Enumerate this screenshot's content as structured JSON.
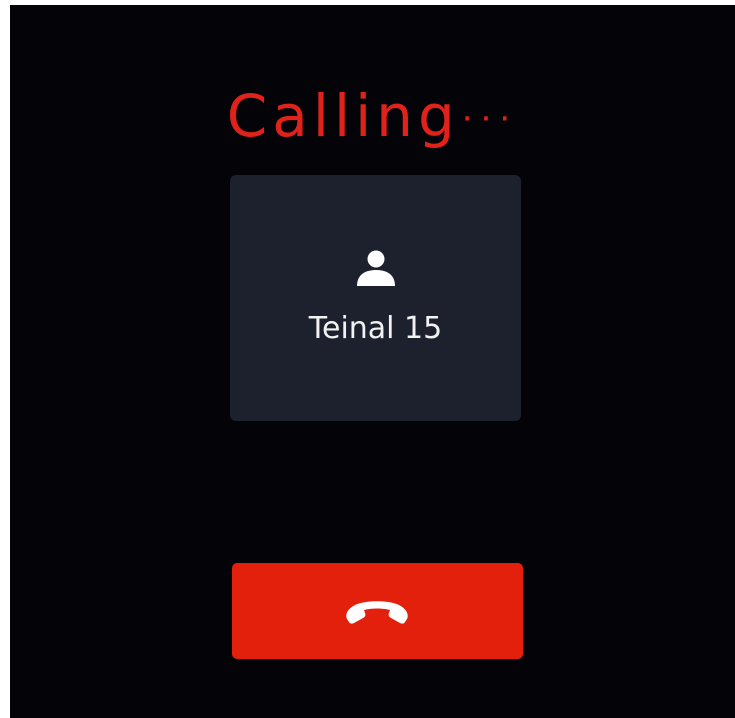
{
  "call": {
    "status_word": "Calling",
    "status_dots": "···",
    "contact_name": "Teinal 15"
  },
  "icons": {
    "avatar": "person-icon",
    "hangup": "phone-hangup-icon"
  },
  "colors": {
    "background": "#030308",
    "accent": "#e0221a",
    "card": "#1d212d",
    "hangup_button": "#e2200c",
    "text": "#f2f2f2"
  }
}
